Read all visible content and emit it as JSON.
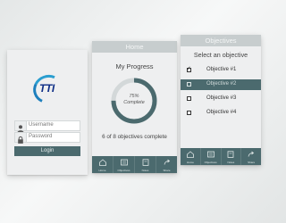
{
  "login": {
    "username_placeholder": "Username",
    "password_placeholder": "Password",
    "login_label": "Login"
  },
  "home": {
    "header_title": "Home",
    "title": "My Progress",
    "progress_percent": 75,
    "progress_label": "75%",
    "progress_sub": "Complete",
    "summary": "6 of 8 objectives complete",
    "tabs": [
      {
        "label": "Home",
        "icon": "home-icon"
      },
      {
        "label": "Objectives",
        "icon": "list-icon"
      },
      {
        "label": "Notes",
        "icon": "notes-icon"
      },
      {
        "label": "Share",
        "icon": "share-icon"
      }
    ]
  },
  "objectives": {
    "header_title": "Objectives",
    "subtitle": "Select an objective",
    "items": [
      {
        "label": "Objective #1",
        "checked": true,
        "selected": false
      },
      {
        "label": "Objective #2",
        "checked": false,
        "selected": true
      },
      {
        "label": "Objective #3",
        "checked": false,
        "selected": false
      },
      {
        "label": "Objective #4",
        "checked": false,
        "selected": false
      }
    ],
    "tabs": [
      {
        "label": "Home",
        "icon": "home-icon"
      },
      {
        "label": "Objectives",
        "icon": "list-icon"
      },
      {
        "label": "Notes",
        "icon": "notes-icon"
      },
      {
        "label": "Share",
        "icon": "share-icon"
      }
    ]
  },
  "colors": {
    "accent": "#4b6a6e",
    "header": "#c7cdce",
    "brand_blue": "#0e2e86",
    "brand_swoosh": "#2a9ed0"
  }
}
